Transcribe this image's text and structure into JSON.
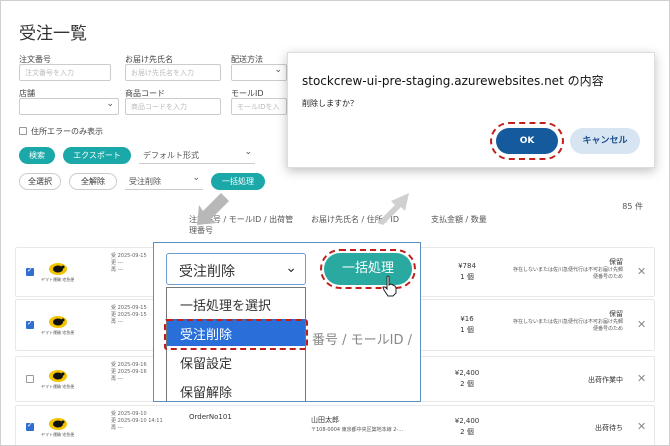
{
  "page": {
    "title": "受注一覧"
  },
  "filters": {
    "order_no": {
      "label": "注文番号",
      "placeholder": "注文番号を入力"
    },
    "recipient": {
      "label": "お届け先氏名",
      "placeholder": "お届け先氏名を入力"
    },
    "ship_method": {
      "label": "配送方法"
    },
    "store": {
      "label": "店舗"
    },
    "product_code": {
      "label": "商品コード",
      "placeholder": "商品コードを入力"
    },
    "mall_id": {
      "label": "モールID",
      "placeholder": "モールIDを入"
    },
    "address_error_only": "住所エラーのみ表示"
  },
  "actions": {
    "search": "検索",
    "export": "エクスポート",
    "format": "デフォルト形式",
    "select_all": "全選択",
    "deselect_all": "全解除",
    "bulk_select": "受注削除",
    "bulk_button": "一括処理"
  },
  "count": "85 件",
  "columns": {
    "order_col": "注文番号 / モールID / 出荷管理番号",
    "recipient_col": "お届け先氏名 / 住所 / ID",
    "amount_col": "支払金額 / 数量"
  },
  "rows": [
    {
      "checked": true,
      "carrier": "ヤマト運輸 宅急便",
      "date1": "2025-09-15",
      "order": "",
      "name": "",
      "addr": "",
      "amount": "¥784",
      "qty": "1 個",
      "status": "保留",
      "status_note": "存在しないまたは佐川急便代行は不可お届け先郵便番号のため"
    },
    {
      "checked": true,
      "carrier": "ヤマト運輸 宅急便",
      "date1": "2025-09-15",
      "date2": "2025-09-15",
      "order": "",
      "name": "",
      "addr": "",
      "amount": "¥16",
      "qty": "1 個",
      "status": "保留",
      "status_note": "存在しないまたは佐川急便代行は不可お届け先郵便番号のため"
    },
    {
      "checked": false,
      "carrier": "ヤマト運輸 宅急便",
      "date1": "2025-09-16",
      "date2": "2025-09-16",
      "order": "",
      "name": "",
      "addr": "",
      "amount": "¥2,400",
      "qty": "2 個",
      "status": "出荷作業中",
      "status_note": ""
    },
    {
      "checked": true,
      "carrier": "ヤマト運輸 宅急便",
      "date1": "2025-09-10",
      "date2": "2025-09-10 14:11",
      "order": "OrderNo101",
      "name": "山田太郎",
      "addr": "〒108-0004 東京都中央区築地本線 2-…",
      "amount": "¥2,400",
      "qty": "2 個",
      "status": "出荷待ち",
      "status_note": ""
    }
  ],
  "row_marks": {
    "m1": "受",
    "m2": "更",
    "m3": "再",
    "dash": "---"
  },
  "dialog": {
    "title": "stockcrew-ui-pre-staging.azurewebsites.net の内容",
    "message": "削除しますか？",
    "ok": "OK",
    "cancel": "キャンセル"
  },
  "zoom": {
    "select_value": "受注削除",
    "options": [
      "一括処理を選択",
      "受注削除",
      "保留設定",
      "保留解除"
    ],
    "button": "一括処理",
    "bg_text": "番号 / モールID /"
  },
  "colors": {
    "teal": "#1ba8a8",
    "ok_blue": "#155a9c",
    "highlight_red": "#c0201c",
    "select_blue": "#2a6fd9"
  }
}
